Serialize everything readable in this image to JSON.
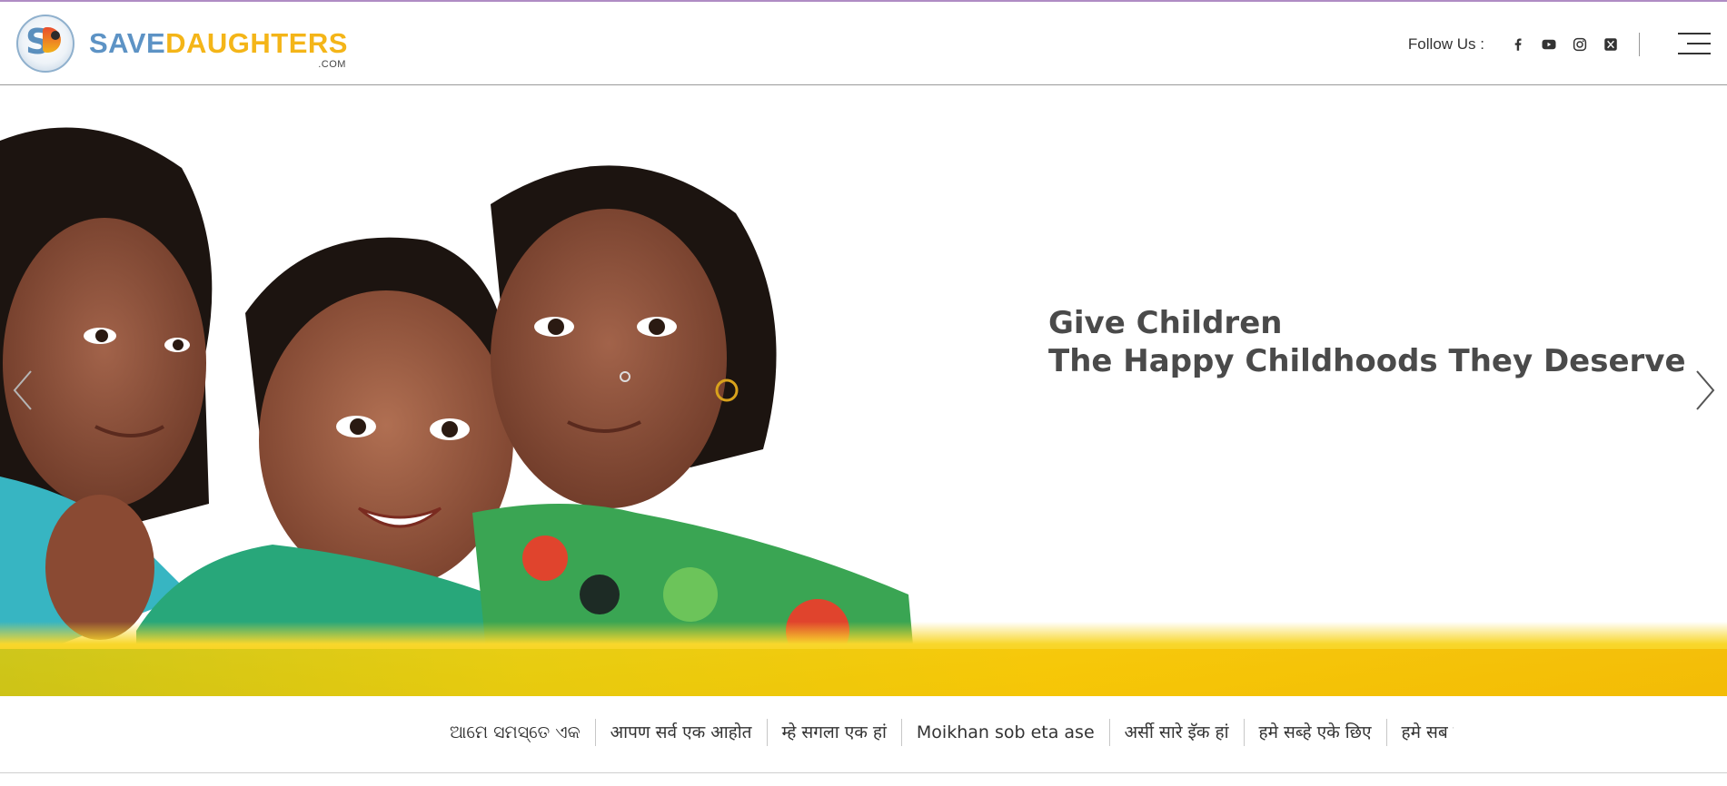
{
  "header": {
    "logo": {
      "mark_letters": "SD",
      "wordmark_part1": "SAVE",
      "wordmark_part2": "DAUGHTERS",
      "wordmark_suffix": ".COM"
    },
    "follow_label": "Follow Us :",
    "social_icons": [
      "facebook-icon",
      "youtube-icon",
      "instagram-icon",
      "x-twitter-icon"
    ],
    "menu_icon": "hamburger-menu-icon"
  },
  "hero": {
    "headline_line1": "Give Children",
    "headline_line2": "The Happy Childhoods They Deserve",
    "prev_icon": "chevron-left-icon",
    "next_icon": "chevron-right-icon"
  },
  "languages": {
    "items": [
      "ଆମେ ସମସ୍ତେ ଏକ",
      "आपण सर्व एक आहोत",
      "म्हे सगला एक हां",
      "Moikhan sob eta ase",
      "अर्सी सारे इॅक हां",
      "हमे सब्हे एके छिए",
      "हमे सब एके हि"
    ]
  },
  "colors": {
    "brand_blue": "#5d93c5",
    "brand_yellow": "#f4b518",
    "headline_text": "#4a4a4a",
    "top_border": "#b08cc4"
  }
}
